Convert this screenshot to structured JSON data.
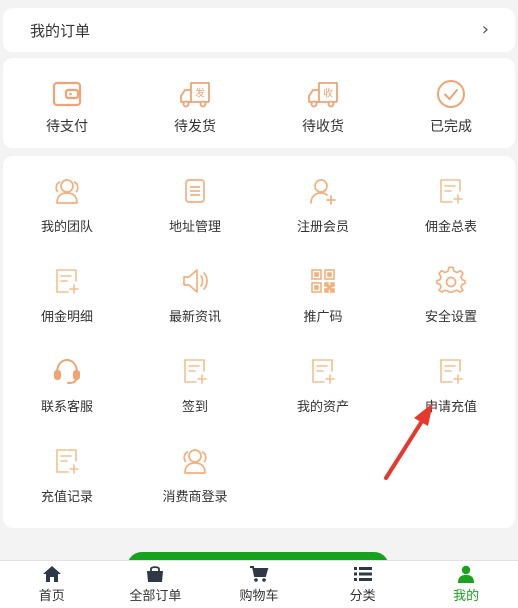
{
  "colors": {
    "icon_orange": "#f0a474",
    "icon_light": "#f4c08f",
    "active_green": "#1aa31f",
    "tab_navy": "#2e3847",
    "arrow_red": "#e8382e"
  },
  "orders": {
    "title": "我的订单",
    "chevron": "›"
  },
  "status": [
    {
      "label": "待支付",
      "icon": "wallet-icon"
    },
    {
      "label": "待发货",
      "icon": "truck-ship-icon",
      "badge": "发"
    },
    {
      "label": "待收货",
      "icon": "truck-receive-icon",
      "badge": "收"
    },
    {
      "label": "已完成",
      "icon": "check-circle-icon"
    }
  ],
  "menu": [
    {
      "label": "我的团队",
      "icon": "team-icon"
    },
    {
      "label": "地址管理",
      "icon": "document-icon"
    },
    {
      "label": "注册会员",
      "icon": "user-add-icon"
    },
    {
      "label": "佣金总表",
      "icon": "doc-plus-icon"
    },
    {
      "label": "佣金明细",
      "icon": "doc-plus-icon"
    },
    {
      "label": "最新资讯",
      "icon": "speaker-icon"
    },
    {
      "label": "推广码",
      "icon": "qr-code-icon"
    },
    {
      "label": "安全设置",
      "icon": "gear-icon"
    },
    {
      "label": "联系客服",
      "icon": "headset-icon"
    },
    {
      "label": "签到",
      "icon": "doc-plus-icon"
    },
    {
      "label": "我的资产",
      "icon": "doc-plus-icon"
    },
    {
      "label": "申请充值",
      "icon": "doc-plus-icon"
    },
    {
      "label": "充值记录",
      "icon": "doc-plus-icon"
    },
    {
      "label": "消费商登录",
      "icon": "team-icon"
    }
  ],
  "tabs": [
    {
      "label": "首页",
      "icon": "home-icon",
      "active": false
    },
    {
      "label": "全部订单",
      "icon": "bag-icon",
      "active": false
    },
    {
      "label": "购物车",
      "icon": "cart-icon",
      "active": false
    },
    {
      "label": "分类",
      "icon": "list-icon",
      "active": false
    },
    {
      "label": "我的",
      "icon": "user-icon",
      "active": true
    }
  ]
}
